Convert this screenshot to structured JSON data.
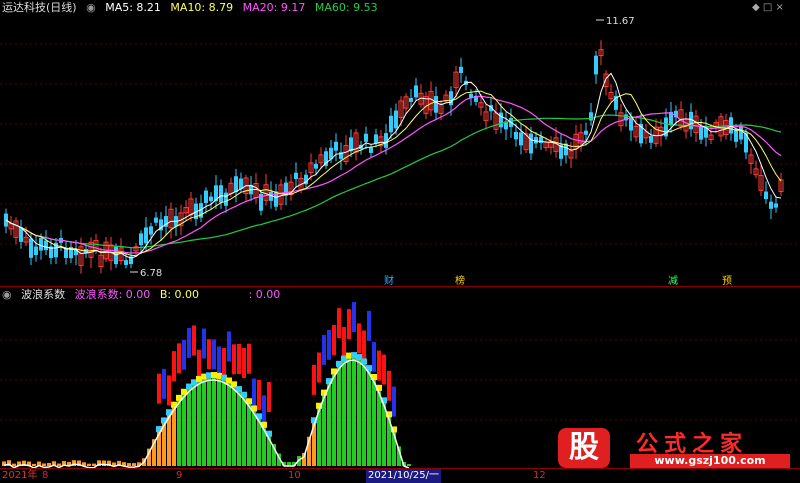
{
  "header": {
    "stock_name": "运达科技(日线)",
    "ma5": "MA5: 8.21",
    "ma10": "MA10: 8.79",
    "ma20": "MA20: 9.17",
    "ma60": "MA60: 9.53",
    "window_controls": "◆ □ ×"
  },
  "price_chart": {
    "high_label": "11.67",
    "low_label": "6.78",
    "event_labels": [
      "财",
      "榜",
      "减",
      "预"
    ],
    "colors": {
      "up": "#ff3b3b",
      "down": "#33ccff",
      "ma5": "#ffffff",
      "ma10": "#ffff66",
      "ma20": "#ff55ff",
      "ma60": "#22cc44"
    }
  },
  "indicator": {
    "name": "波浪系数",
    "value_label": "波浪系数: 0.00",
    "b_label": "B: 0.00",
    "extra_label": ": 0.00"
  },
  "time_axis": {
    "labels": [
      "2021年",
      "8",
      "9",
      "10",
      "2021/10/25/一",
      "12"
    ]
  },
  "watermark": {
    "big_char": "股",
    "site_title": "公式之家",
    "url": "www.gszj100.com"
  }
}
